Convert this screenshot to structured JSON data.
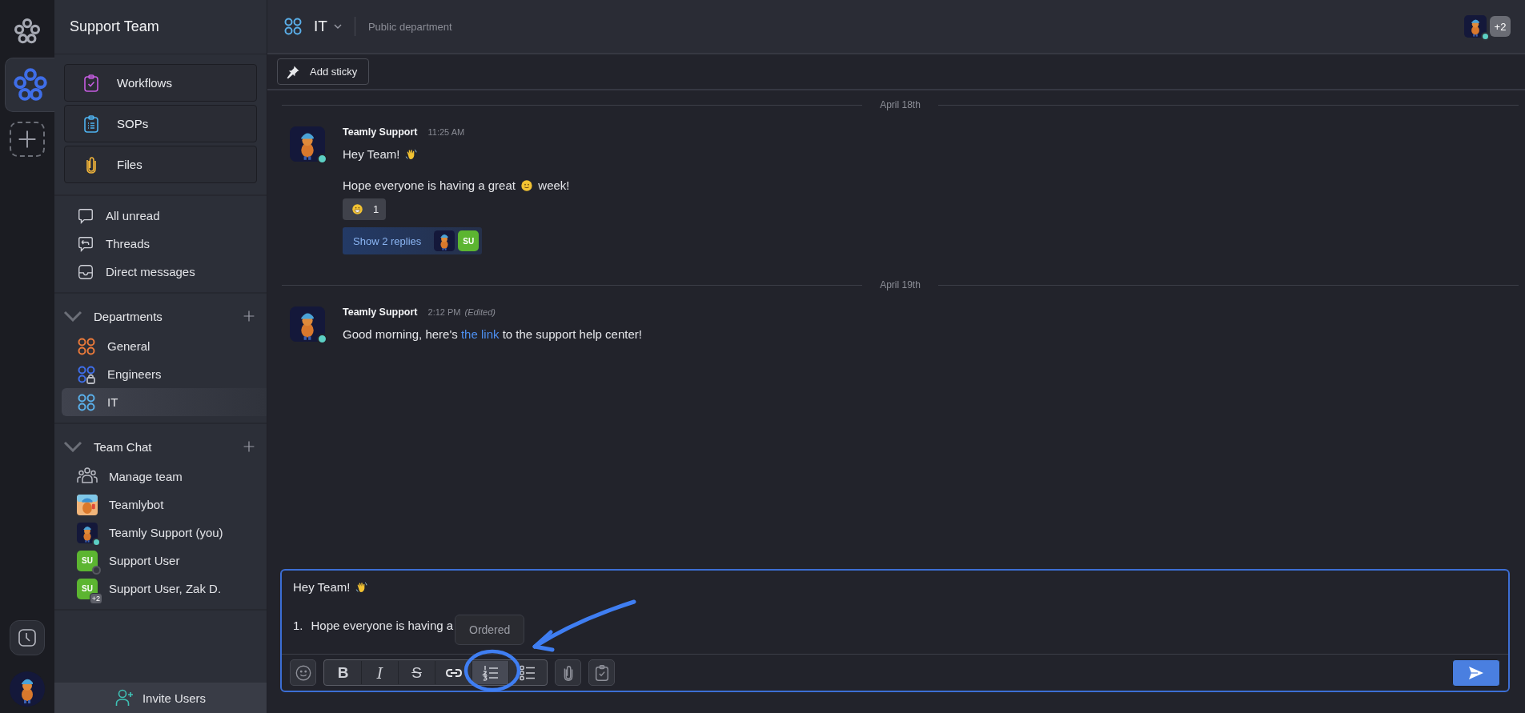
{
  "rail": {
    "workspaces": [
      {
        "selected": true
      }
    ]
  },
  "sidebar": {
    "title": "Support Team",
    "shortcuts": [
      {
        "kind": "workflows",
        "label": "Workflows"
      },
      {
        "kind": "sops",
        "label": "SOPs"
      },
      {
        "kind": "files",
        "label": "Files"
      }
    ],
    "nav": [
      {
        "kind": "unread",
        "label": "All unread"
      },
      {
        "kind": "threads",
        "label": "Threads"
      },
      {
        "kind": "direct",
        "label": "Direct messages"
      }
    ],
    "sections": [
      {
        "title": "Departments",
        "expanded": true,
        "items": [
          {
            "kind": "public",
            "label": "General",
            "color": "#e8793a",
            "selected": false
          },
          {
            "kind": "private",
            "label": "Engineers",
            "color": "#3f6ee8",
            "selected": false
          },
          {
            "kind": "public",
            "label": "IT",
            "color": "#5aaee8",
            "selected": true
          }
        ]
      },
      {
        "title": "Team Chat",
        "expanded": true,
        "items": [
          {
            "kind": "team",
            "label": "Manage team",
            "selected": false
          },
          {
            "kind": "bot",
            "label": "Teamlybot",
            "selected": false
          },
          {
            "kind": "mascot",
            "label": "Teamly Support (you)",
            "online": true,
            "selected": false
          },
          {
            "kind": "initials",
            "initials": "SU",
            "label": "Support User",
            "online": false,
            "selected": false
          },
          {
            "kind": "initials",
            "initials": "SU",
            "label": "Support User, Zak D.",
            "extra": "+2",
            "selected": false
          }
        ]
      }
    ],
    "invite": "Invite Users"
  },
  "header": {
    "channel": "IT",
    "description": "Public department",
    "member_online": true,
    "member_extra": "+2"
  },
  "toolbar": {
    "sticky": "Add sticky"
  },
  "days": [
    {
      "date": "April 18th",
      "messages": [
        {
          "author": "Teamly Support",
          "time": "11:25 AM",
          "online": true,
          "paragraphs": [
            [
              {
                "kind": "text",
                "text": "Hey Team! "
              },
              {
                "kind": "wave"
              }
            ],
            [
              {
                "kind": "text",
                "text": "Hope everyone is having a great "
              },
              {
                "kind": "smile"
              },
              {
                "kind": "text",
                "text": " week!"
              }
            ]
          ],
          "reactions": [
            {
              "kind": "grin",
              "count": "1"
            }
          ],
          "replies": {
            "label": "Show 2 replies",
            "avatars": [
              {
                "kind": "mascot"
              },
              {
                "kind": "initials",
                "initials": "SU"
              }
            ]
          }
        }
      ]
    },
    {
      "date": "April 19th",
      "messages": [
        {
          "author": "Teamly Support",
          "time": "2:12 PM",
          "edited": "(Edited)",
          "online": true,
          "paragraphs": [
            [
              {
                "kind": "text",
                "text": "Good morning, here's "
              },
              {
                "kind": "link",
                "text": "the link"
              },
              {
                "kind": "text",
                "text": " to the support help center!"
              }
            ]
          ]
        }
      ]
    }
  ],
  "composer": {
    "first_line": [
      {
        "kind": "text",
        "text": "Hey Team! "
      },
      {
        "kind": "wave"
      }
    ],
    "list_items": [
      {
        "number": "1.",
        "text": "Hope everyone is having a"
      }
    ],
    "tooltip": "Ordered",
    "tools": [
      {
        "kind": "emoji",
        "selected": false
      },
      {
        "kind": "bold",
        "label": "B",
        "selected": false
      },
      {
        "kind": "italic",
        "label": "I",
        "selected": false
      },
      {
        "kind": "strike",
        "label": "S",
        "selected": false
      },
      {
        "kind": "link",
        "selected": false
      },
      {
        "kind": "ordered",
        "selected": true
      },
      {
        "kind": "bullet",
        "selected": false
      },
      {
        "kind": "attach",
        "selected": false
      },
      {
        "kind": "task",
        "selected": false
      }
    ]
  }
}
